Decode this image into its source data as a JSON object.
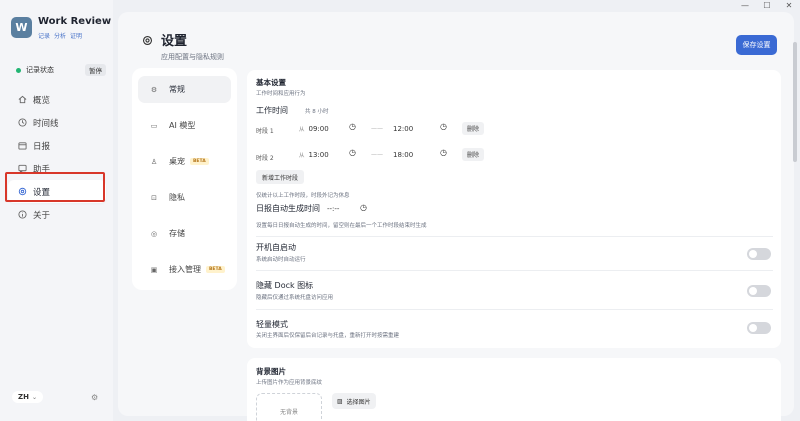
{
  "window": {
    "controls": [
      "—",
      "☐",
      "✕"
    ]
  },
  "app": {
    "title": "Work Review",
    "sub_links": [
      "记录",
      "分析",
      "证明"
    ]
  },
  "status": {
    "label": "记录状态",
    "button": "暂停",
    "color": "#22b573"
  },
  "sidebar": {
    "items": [
      {
        "label": "概览",
        "icon": "home-icon"
      },
      {
        "label": "时间线",
        "icon": "clock-icon"
      },
      {
        "label": "日报",
        "icon": "calendar-icon"
      },
      {
        "label": "助手",
        "icon": "chat-icon"
      },
      {
        "label": "设置",
        "icon": "gear-icon",
        "active": true
      },
      {
        "label": "关于",
        "icon": "info-icon"
      }
    ],
    "lang": "ZH"
  },
  "header": {
    "title": "设置",
    "subtitle": "应用配置与隐私规则",
    "save_label": "保存设置",
    "accent": "#3a6ad4"
  },
  "settings_menu": [
    {
      "label": "常规",
      "active": true
    },
    {
      "label": "AI 模型"
    },
    {
      "label": "桌宠",
      "beta": "BETA"
    },
    {
      "label": "隐私"
    },
    {
      "label": "存储"
    },
    {
      "label": "接入管理",
      "beta": "BETA"
    }
  ],
  "basic": {
    "title": "基本设置",
    "desc": "工作时间和应用行为",
    "work_time_label": "工作时间",
    "work_time_total": "共 8 小时",
    "periods": [
      {
        "label": "时段 1",
        "from_prefix": "从",
        "start": "09:00",
        "end": "12:00",
        "delete": "删除"
      },
      {
        "label": "时段 2",
        "from_prefix": "从",
        "start": "13:00",
        "end": "18:00",
        "delete": "删除"
      }
    ],
    "add_period": "新增工作时段",
    "period_note": "仅统计以上工作时段，时段外记为休息",
    "report_label": "日报自动生成时间",
    "report_time": "--:--",
    "report_note": "设置每日日报自动生成的时间，留空则在最后一个工作时段结束时生成"
  },
  "toggles": [
    {
      "title": "开机自启动",
      "desc": "系统启动时自动运行",
      "on": false
    },
    {
      "title": "隐藏 Dock 图标",
      "desc": "隐藏后仅通过系统托盘访问应用",
      "on": false
    },
    {
      "title": "轻量模式",
      "desc": "关闭主界面后仅保留后台记录与托盘，重新打开时按需重建",
      "on": false
    }
  ],
  "background": {
    "title": "背景图片",
    "desc": "上传图片作为应用背景底纹",
    "none_label": "无背景",
    "choose_label": "选择图片"
  }
}
